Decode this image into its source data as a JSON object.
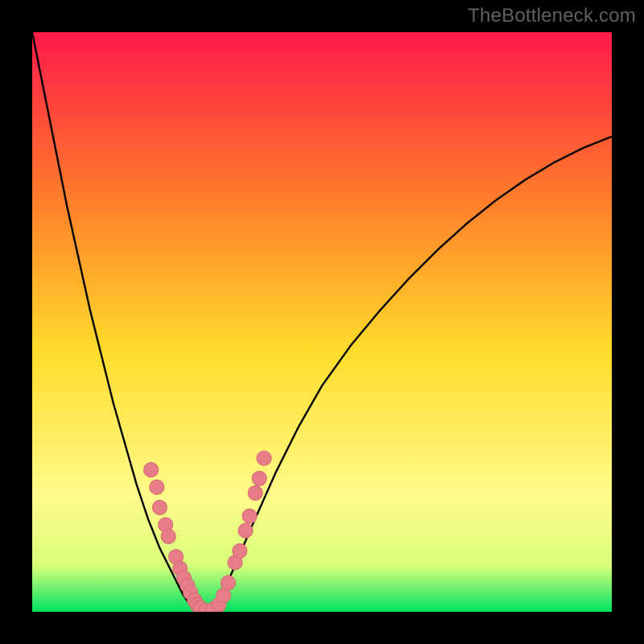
{
  "watermark": "TheBottleneck.com",
  "colors": {
    "background": "#000000",
    "gradient_top": "#ff1a4b",
    "gradient_mid_upper": "#ff7a2a",
    "gradient_mid": "#ffdc2a",
    "gradient_lower": "#fffb8a",
    "gradient_band": "#d8ff7a",
    "gradient_bottom": "#00e060",
    "curve": "#000000",
    "marker_fill": "#e77d87",
    "marker_stroke": "#d66a75"
  },
  "chart_data": {
    "type": "line",
    "title": "",
    "xlabel": "",
    "ylabel": "",
    "x": [
      0.0,
      0.02,
      0.04,
      0.06,
      0.08,
      0.1,
      0.12,
      0.14,
      0.16,
      0.18,
      0.2,
      0.22,
      0.24,
      0.26,
      0.27,
      0.28,
      0.29,
      0.3,
      0.31,
      0.32,
      0.33,
      0.35,
      0.38,
      0.42,
      0.46,
      0.5,
      0.55,
      0.6,
      0.65,
      0.7,
      0.75,
      0.8,
      0.85,
      0.9,
      0.95,
      1.0
    ],
    "values": [
      1.0,
      0.9,
      0.8,
      0.7,
      0.61,
      0.52,
      0.44,
      0.36,
      0.29,
      0.22,
      0.16,
      0.11,
      0.07,
      0.03,
      0.015,
      0.005,
      0.0,
      0.0,
      0.005,
      0.015,
      0.035,
      0.08,
      0.15,
      0.24,
      0.32,
      0.39,
      0.46,
      0.52,
      0.575,
      0.625,
      0.67,
      0.71,
      0.745,
      0.775,
      0.8,
      0.82
    ],
    "xlim": [
      0,
      1
    ],
    "ylim": [
      0,
      1
    ],
    "markers": [
      {
        "x": 0.205,
        "y": 0.245
      },
      {
        "x": 0.215,
        "y": 0.215
      },
      {
        "x": 0.22,
        "y": 0.18
      },
      {
        "x": 0.23,
        "y": 0.15
      },
      {
        "x": 0.235,
        "y": 0.13
      },
      {
        "x": 0.248,
        "y": 0.095
      },
      {
        "x": 0.255,
        "y": 0.075
      },
      {
        "x": 0.262,
        "y": 0.058
      },
      {
        "x": 0.268,
        "y": 0.045
      },
      {
        "x": 0.273,
        "y": 0.033
      },
      {
        "x": 0.28,
        "y": 0.02
      },
      {
        "x": 0.285,
        "y": 0.012
      },
      {
        "x": 0.29,
        "y": 0.006
      },
      {
        "x": 0.3,
        "y": 0.002
      },
      {
        "x": 0.312,
        "y": 0.004
      },
      {
        "x": 0.322,
        "y": 0.012
      },
      {
        "x": 0.33,
        "y": 0.028
      },
      {
        "x": 0.338,
        "y": 0.05
      },
      {
        "x": 0.35,
        "y": 0.085
      },
      {
        "x": 0.358,
        "y": 0.105
      },
      {
        "x": 0.368,
        "y": 0.14
      },
      {
        "x": 0.375,
        "y": 0.165
      },
      {
        "x": 0.385,
        "y": 0.205
      },
      {
        "x": 0.392,
        "y": 0.23
      },
      {
        "x": 0.4,
        "y": 0.265
      }
    ]
  }
}
